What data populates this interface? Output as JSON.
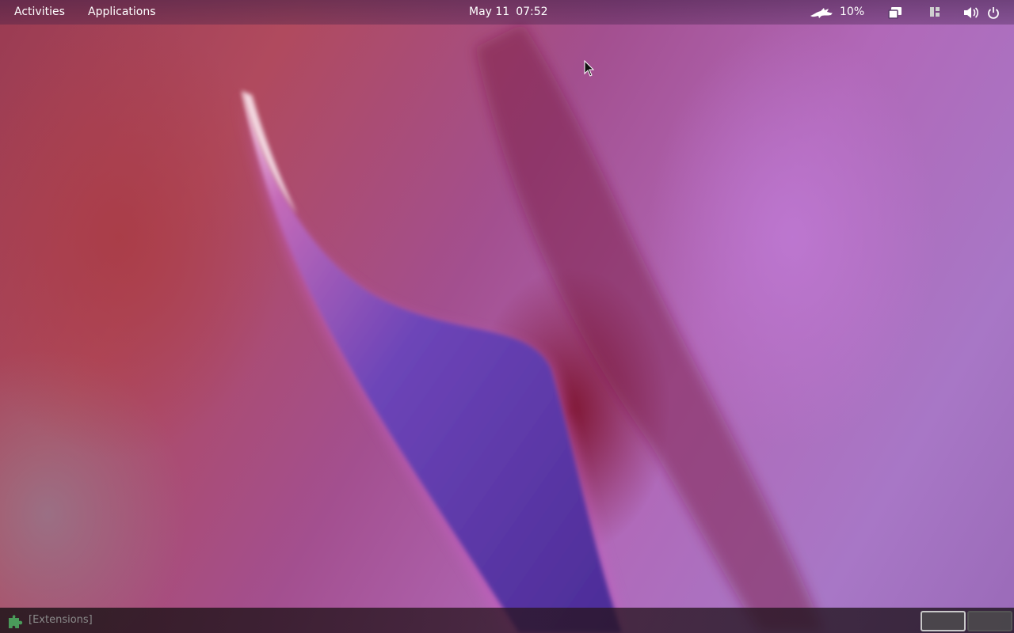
{
  "top_bar": {
    "activities_label": "Activities",
    "applications_label": "Applications",
    "date": "May 11",
    "time": "07:52",
    "battery_percent": "10%",
    "icons": [
      "weather-icon",
      "window-icon",
      "layout-icon",
      "volume-icon",
      "power-icon"
    ]
  },
  "bottom_bar": {
    "extensions_label": "[Extensions]",
    "workspaces": [
      "workspace-1",
      "workspace-2"
    ],
    "active_workspace": 1
  },
  "colors": {
    "top_bar_text": "#ffffff",
    "extensions_text": "#8a8a8a",
    "extension_icon": "#4a9a5a"
  }
}
